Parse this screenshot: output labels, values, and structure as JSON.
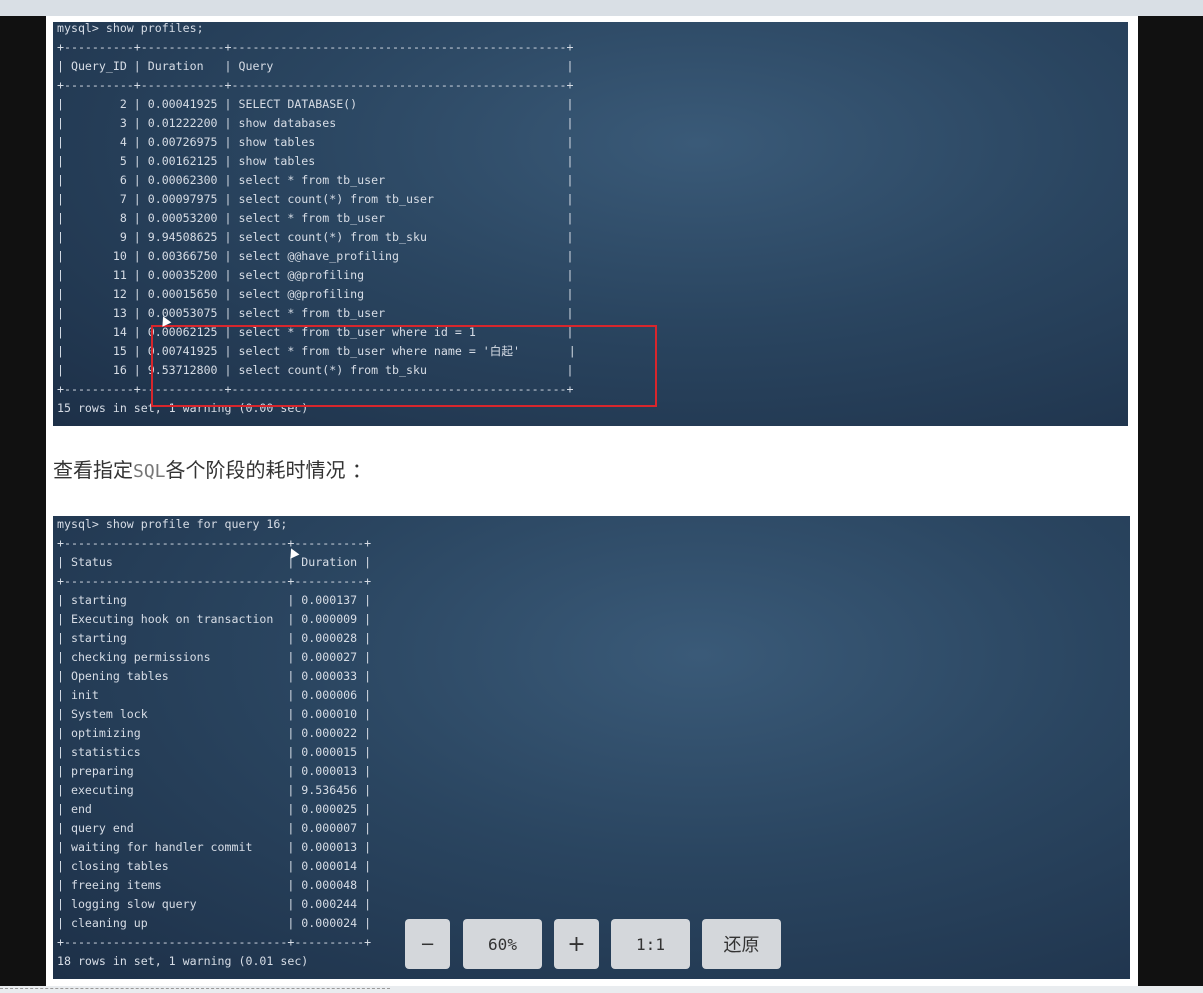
{
  "terminal1": {
    "lines": [
      "mysql> show profiles;",
      "+----------+------------+------------------------------------------------+",
      "| Query_ID | Duration   | Query                                          |",
      "+----------+------------+------------------------------------------------+",
      "|        2 | 0.00041925 | SELECT DATABASE()                              |",
      "|        3 | 0.01222200 | show databases                                 |",
      "|        4 | 0.00726975 | show tables                                    |",
      "|        5 | 0.00162125 | show tables                                    |",
      "|        6 | 0.00062300 | select * from tb_user                          |",
      "|        7 | 0.00097975 | select count(*) from tb_user                   |",
      "|        8 | 0.00053200 | select * from tb_user                          |",
      "|        9 | 9.94508625 | select count(*) from tb_sku                    |",
      "|       10 | 0.00366750 | select @@have_profiling                        |",
      "|       11 | 0.00035200 | select @@profiling                             |",
      "|       12 | 0.00015650 | select @@profiling                             |",
      "|       13 | 0.00053075 | select * from tb_user                          |",
      "|       14 | 0.00062125 | select * from tb_user where id = 1             |",
      "|       15 | 0.00741925 | select * from tb_user where name = '白起'       |",
      "|       16 | 9.53712800 | select count(*) from tb_sku                    |",
      "+----------+------------+------------------------------------------------+",
      "15 rows in set, 1 warning (0.00 sec)"
    ]
  },
  "heading": {
    "prefix": "查看指定",
    "code": "SQL",
    "suffix": "各个阶段的耗时情况 ："
  },
  "terminal2": {
    "lines": [
      "mysql> show profile for query 16;",
      "+--------------------------------+----------+",
      "| Status                         | Duration |",
      "+--------------------------------+----------+",
      "| starting                       | 0.000137 |",
      "| Executing hook on transaction  | 0.000009 |",
      "| starting                       | 0.000028 |",
      "| checking permissions           | 0.000027 |",
      "| Opening tables                 | 0.000033 |",
      "| init                           | 0.000006 |",
      "| System lock                    | 0.000010 |",
      "| optimizing                     | 0.000022 |",
      "| statistics                     | 0.000015 |",
      "| preparing                      | 0.000013 |",
      "| executing                      | 9.536456 |",
      "| end                            | 0.000025 |",
      "| query end                      | 0.000007 |",
      "| waiting for handler commit     | 0.000013 |",
      "| closing tables                 | 0.000014 |",
      "| freeing items                  | 0.000048 |",
      "| logging slow query             | 0.000244 |",
      "| cleaning up                    | 0.000024 |",
      "+--------------------------------+----------+",
      "18 rows in set, 1 warning (0.01 sec)"
    ]
  },
  "toolbar": {
    "zoom_out": "−",
    "zoom_level": "60%",
    "zoom_in": "+",
    "actual_size": "1:1",
    "restore": "还原"
  }
}
